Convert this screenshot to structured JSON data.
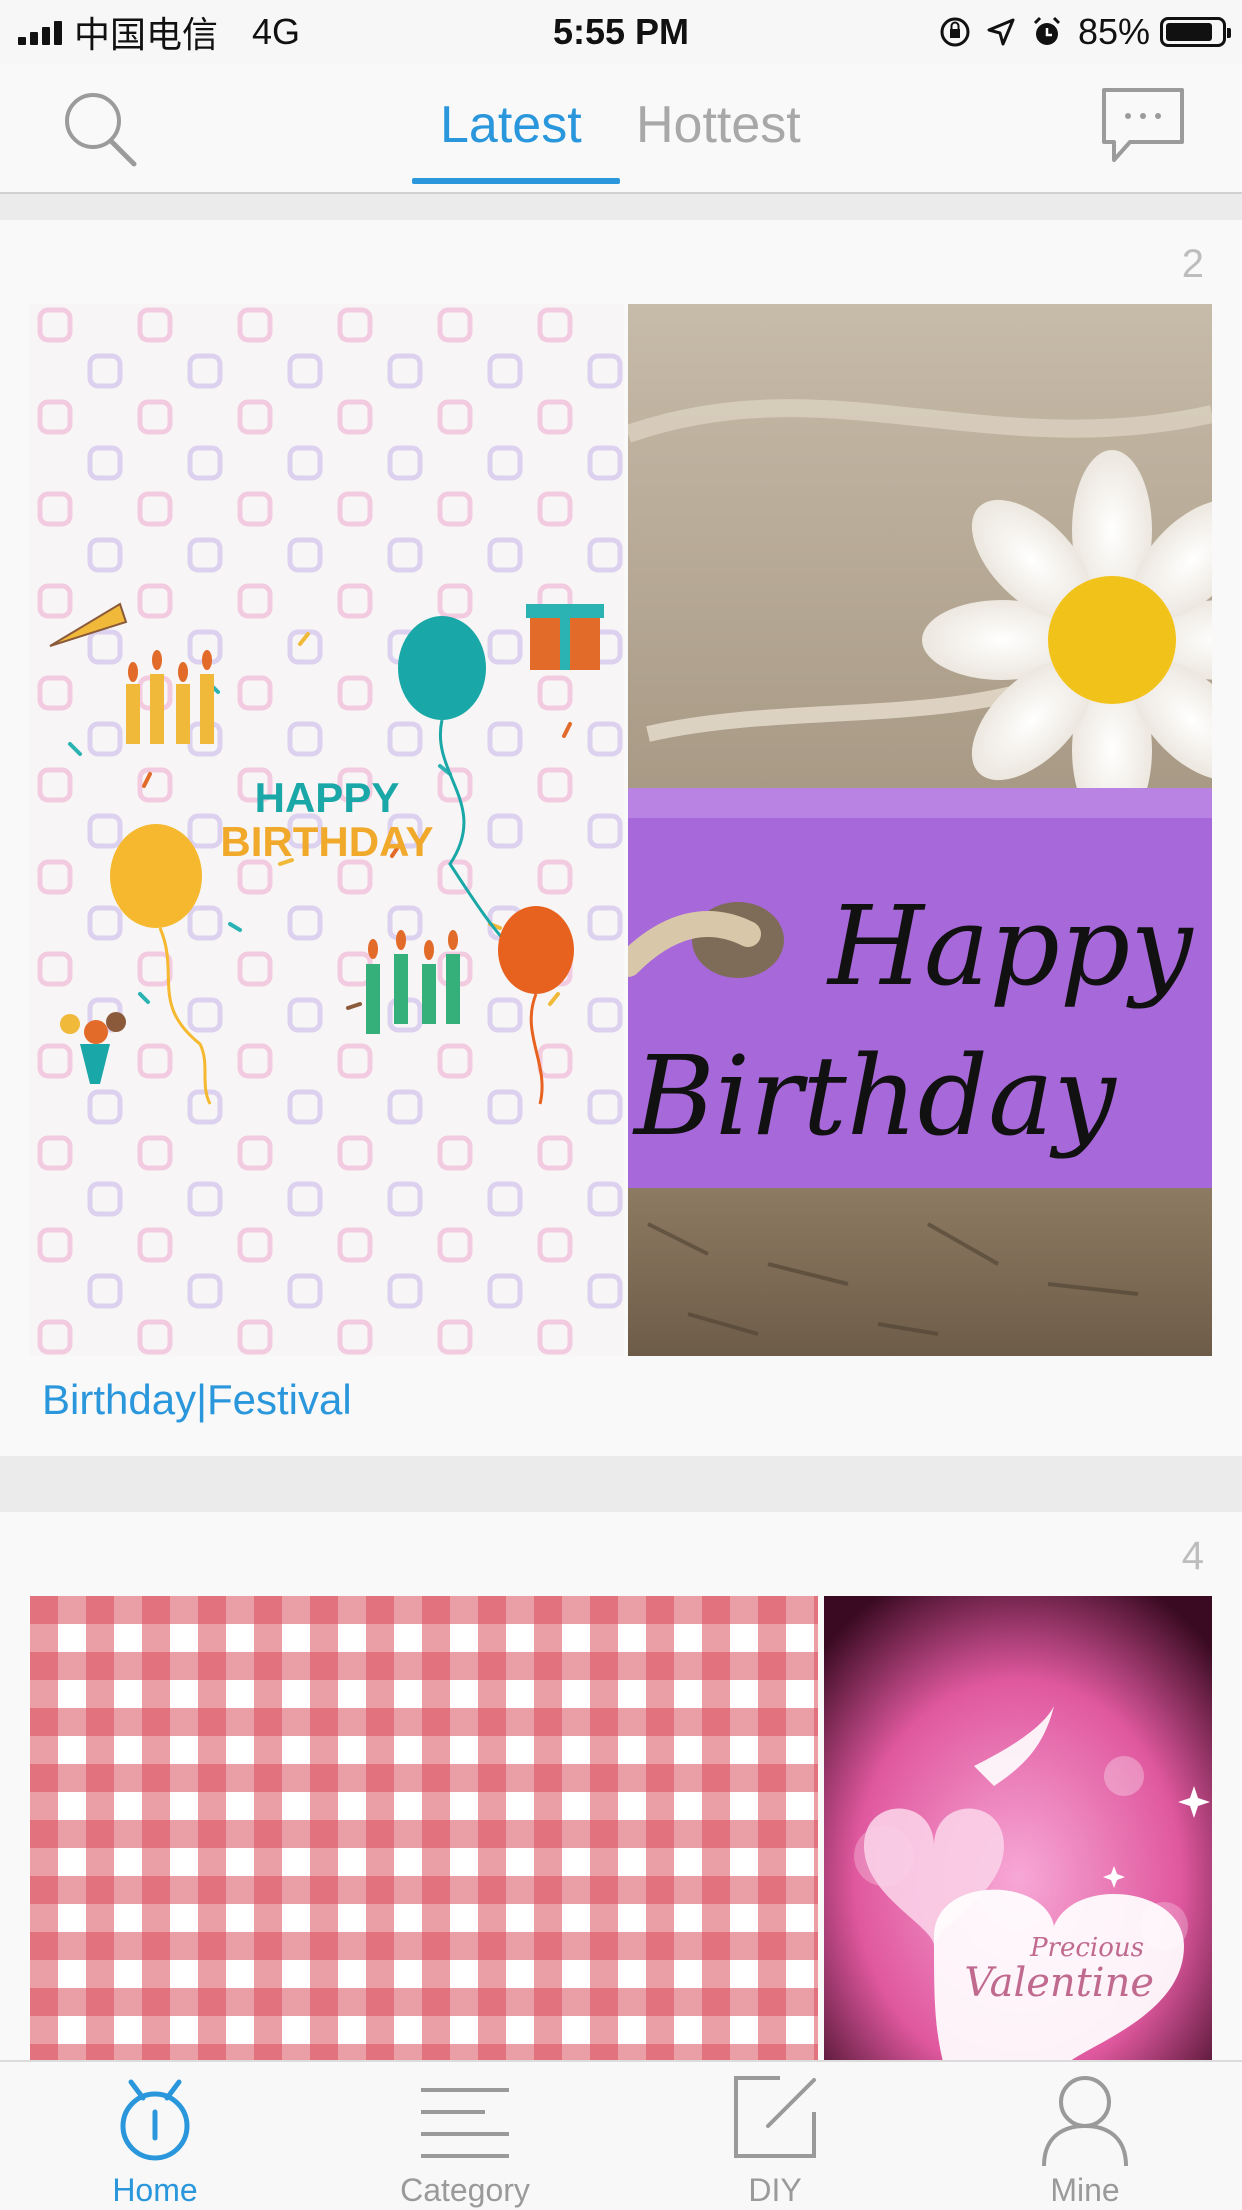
{
  "status_bar": {
    "carrier": "中国电信",
    "network": "4G",
    "time": "5:55 PM",
    "battery": "85%",
    "battery_level": 0.85
  },
  "nav": {
    "tabs": [
      {
        "label": "Latest",
        "active": true
      },
      {
        "label": "Hottest",
        "active": false
      }
    ],
    "search_icon": "search-icon",
    "message_icon": "message-icon"
  },
  "feed": {
    "cards": [
      {
        "count": "2",
        "tags": "Birthday|Festival",
        "images": [
          {
            "art_text": "HAPPY BIRTHDAY"
          },
          {
            "art_text": "Happy Birthday"
          }
        ]
      },
      {
        "count": "4",
        "images": [
          {
            "art_text": ""
          },
          {
            "art_text": "Precious Valentine"
          }
        ]
      }
    ]
  },
  "tabbar": {
    "items": [
      {
        "label": "Home",
        "icon": "home-icon",
        "active": true
      },
      {
        "label": "Category",
        "icon": "category-icon",
        "active": false
      },
      {
        "label": "DIY",
        "icon": "diy-icon",
        "active": false
      },
      {
        "label": "Mine",
        "icon": "mine-icon",
        "active": false
      }
    ]
  },
  "colors": {
    "accent": "#2a97dc",
    "inactive": "#a8a8a8"
  }
}
